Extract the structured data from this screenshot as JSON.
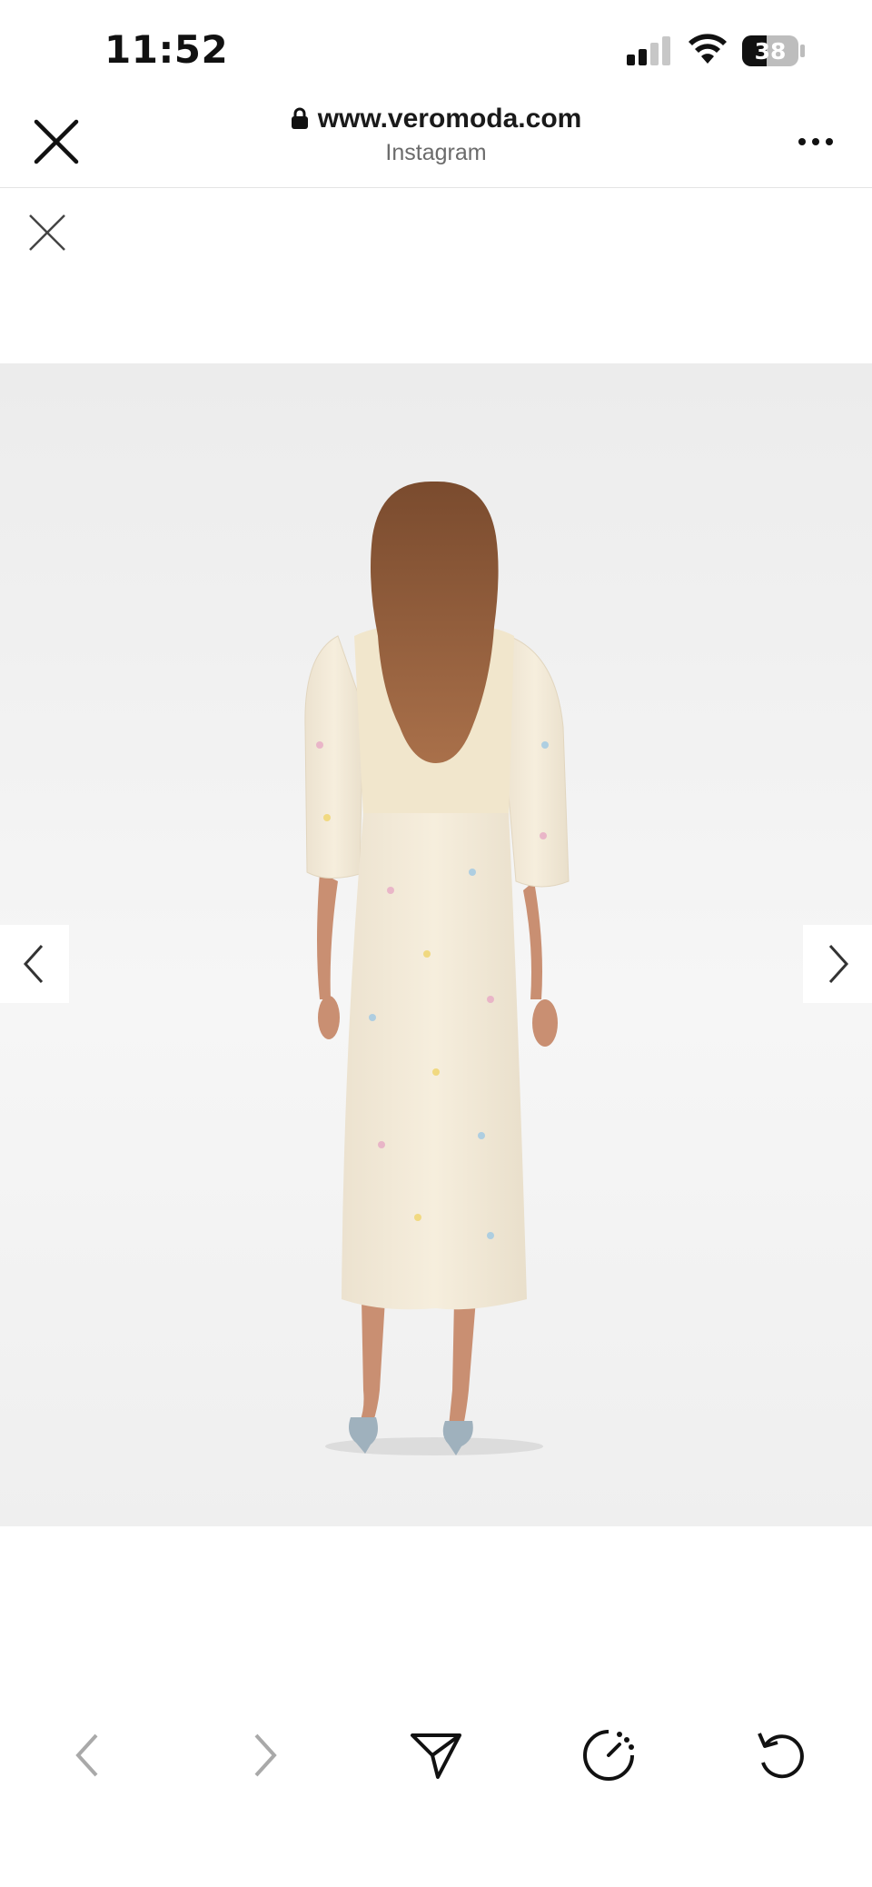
{
  "status_bar": {
    "time": "11:52",
    "battery_level": "38",
    "icons": [
      "signal-icon",
      "wifi-icon",
      "battery-icon"
    ]
  },
  "browser": {
    "url": "www.veromoda.com",
    "source": "Instagram",
    "icons": [
      "close-icon",
      "lock-icon",
      "more-icon"
    ]
  },
  "gallery": {
    "icons": [
      "close-icon",
      "chevron-left-icon",
      "chevron-right-icon"
    ],
    "product_colors": {
      "dress": "#f3ead8",
      "hair": "#8a5a3b",
      "background": "#efefef"
    }
  },
  "toolbar": {
    "icons": [
      "back-icon",
      "forward-icon",
      "share-icon",
      "history-icon",
      "reload-icon"
    ]
  }
}
